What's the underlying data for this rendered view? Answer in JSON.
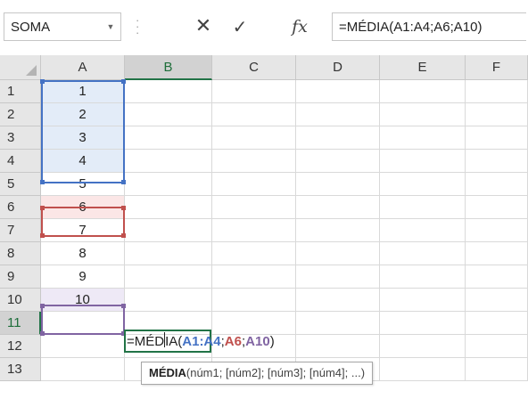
{
  "formula_bar": {
    "name_box": "SOMA",
    "name_box_dropdown_icon": "chevron-down-icon",
    "cancel_icon": "close-icon",
    "enter_icon": "checkmark-icon",
    "fx_label": "fx",
    "formula": "=MÉDIA(A1:A4;A6;A10)"
  },
  "columns": [
    "A",
    "B",
    "C",
    "D",
    "E",
    "F"
  ],
  "active_column": "B",
  "rows": [
    "1",
    "2",
    "3",
    "4",
    "5",
    "6",
    "7",
    "8",
    "9",
    "10",
    "11",
    "12",
    "13"
  ],
  "active_row": "11",
  "cells_A": [
    "1",
    "2",
    "3",
    "4",
    "5",
    "6",
    "7",
    "8",
    "9",
    "10",
    "",
    "",
    ""
  ],
  "editing_cell": {
    "prefix": "=MÉD",
    "rest": "IA(",
    "ref1": "A1:A4",
    "sep1": ";",
    "ref2": "A6",
    "sep2": ";",
    "ref3": "A10",
    "close": ")"
  },
  "tooltip": {
    "function": "MÉDIA",
    "args": "(núm1; [núm2]; [núm3]; [núm4]; ...)"
  },
  "colors": {
    "ref1": "#4472c4",
    "ref2": "#c0504d",
    "ref3": "#8064a2",
    "active": "#217346"
  }
}
